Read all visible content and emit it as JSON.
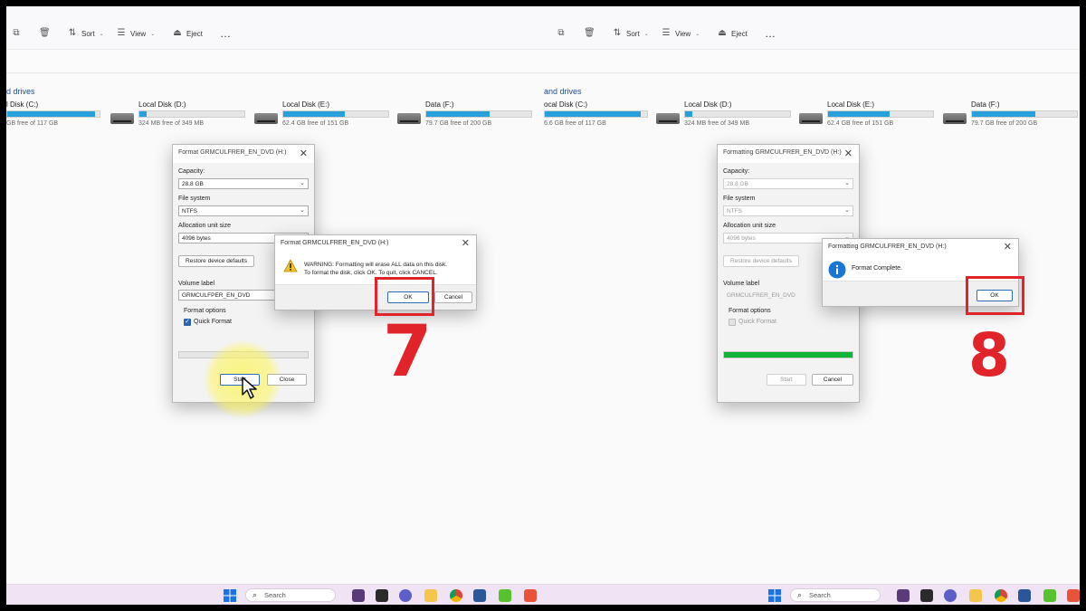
{
  "toolbar": {
    "sort_label": "Sort",
    "view_label": "View",
    "eject_label": "Eject",
    "more_label": "…"
  },
  "section_title": {
    "left": "d drives",
    "right": "and drives"
  },
  "drives_left": [
    {
      "name": "l Disk (C:)",
      "free": "GB free of 117 GB",
      "used_fraction": 0.95
    },
    {
      "name": "Local Disk (D:)",
      "free": "324 MB free of 349 MB",
      "used_fraction": 0.07
    },
    {
      "name": "Local Disk (E:)",
      "free": "62.4 GB free of 151 GB",
      "used_fraction": 0.59
    },
    {
      "name": "Data (F:)",
      "free": "79.7 GB free of 200 GB",
      "used_fraction": 0.6
    }
  ],
  "drives_right": [
    {
      "name": "ocal Disk (C:)",
      "free": "6.6 GB free of 117 GB",
      "used_fraction": 0.94
    },
    {
      "name": "Local Disk (D:)",
      "free": "324 MB free of 349 MB",
      "used_fraction": 0.07
    },
    {
      "name": "Local Disk (E:)",
      "free": "62.4 GB free of 151 GB",
      "used_fraction": 0.59
    },
    {
      "name": "Data (F:)",
      "free": "79.7 GB free of 200 GB",
      "used_fraction": 0.6
    }
  ],
  "format_dialog_left": {
    "title": "Format GRMCULFRER_EN_DVD (H:)",
    "capacity_label": "Capacity:",
    "capacity_value": "28.8 GB",
    "filesystem_label": "File system",
    "filesystem_value": "NTFS",
    "alloc_label": "Allocation unit size",
    "alloc_value": "4096 bytes",
    "restore_label": "Restore device defaults",
    "volume_label": "Volume label",
    "volume_value": "GRMCULFPER_EN_DVD",
    "options_label": "Format options",
    "quick_format_label": "Quick Format",
    "quick_format_checked": true,
    "progress": 0,
    "start_label": "Start",
    "close_label": "Close"
  },
  "format_dialog_right": {
    "title": "Formatting GRMCULFRER_EN_DVD (H:)",
    "capacity_label": "Capacity:",
    "capacity_value": "28.8 GB",
    "filesystem_label": "File system",
    "filesystem_value": "NTFS",
    "alloc_label": "Allocation unit size",
    "alloc_value": "4096 bytes",
    "restore_label": "Restore device defaults",
    "volume_label": "Volume label",
    "volume_value": "GRMCULFRER_EN_DVD",
    "options_label": "Format options",
    "quick_format_label": "Quick Format",
    "quick_format_checked": false,
    "progress": 1,
    "start_label": "Start",
    "close_label": "Cancel"
  },
  "warning_dialog": {
    "title": "Format GRMCULFRER_EN_DVD (H:)",
    "line1": "WARNING: Formatting will erase ALL data on this disk.",
    "line2": "To format the disk, click OK. To quit, click CANCEL.",
    "ok_label": "OK",
    "cancel_label": "Cancel"
  },
  "complete_dialog": {
    "title": "Formatting GRMCULFRER_EN_DVD (H:)",
    "message": "Format Complete.",
    "ok_label": "OK"
  },
  "step_numbers": {
    "left": "7",
    "right": "8"
  },
  "taskbar": {
    "search_placeholder": "Search"
  },
  "colors": {
    "highlight_red": "#e0242a",
    "drive_bar_blue": "#26a0da",
    "progress_green": "#0cb334",
    "taskbar_bg": "#f0e3f3"
  }
}
